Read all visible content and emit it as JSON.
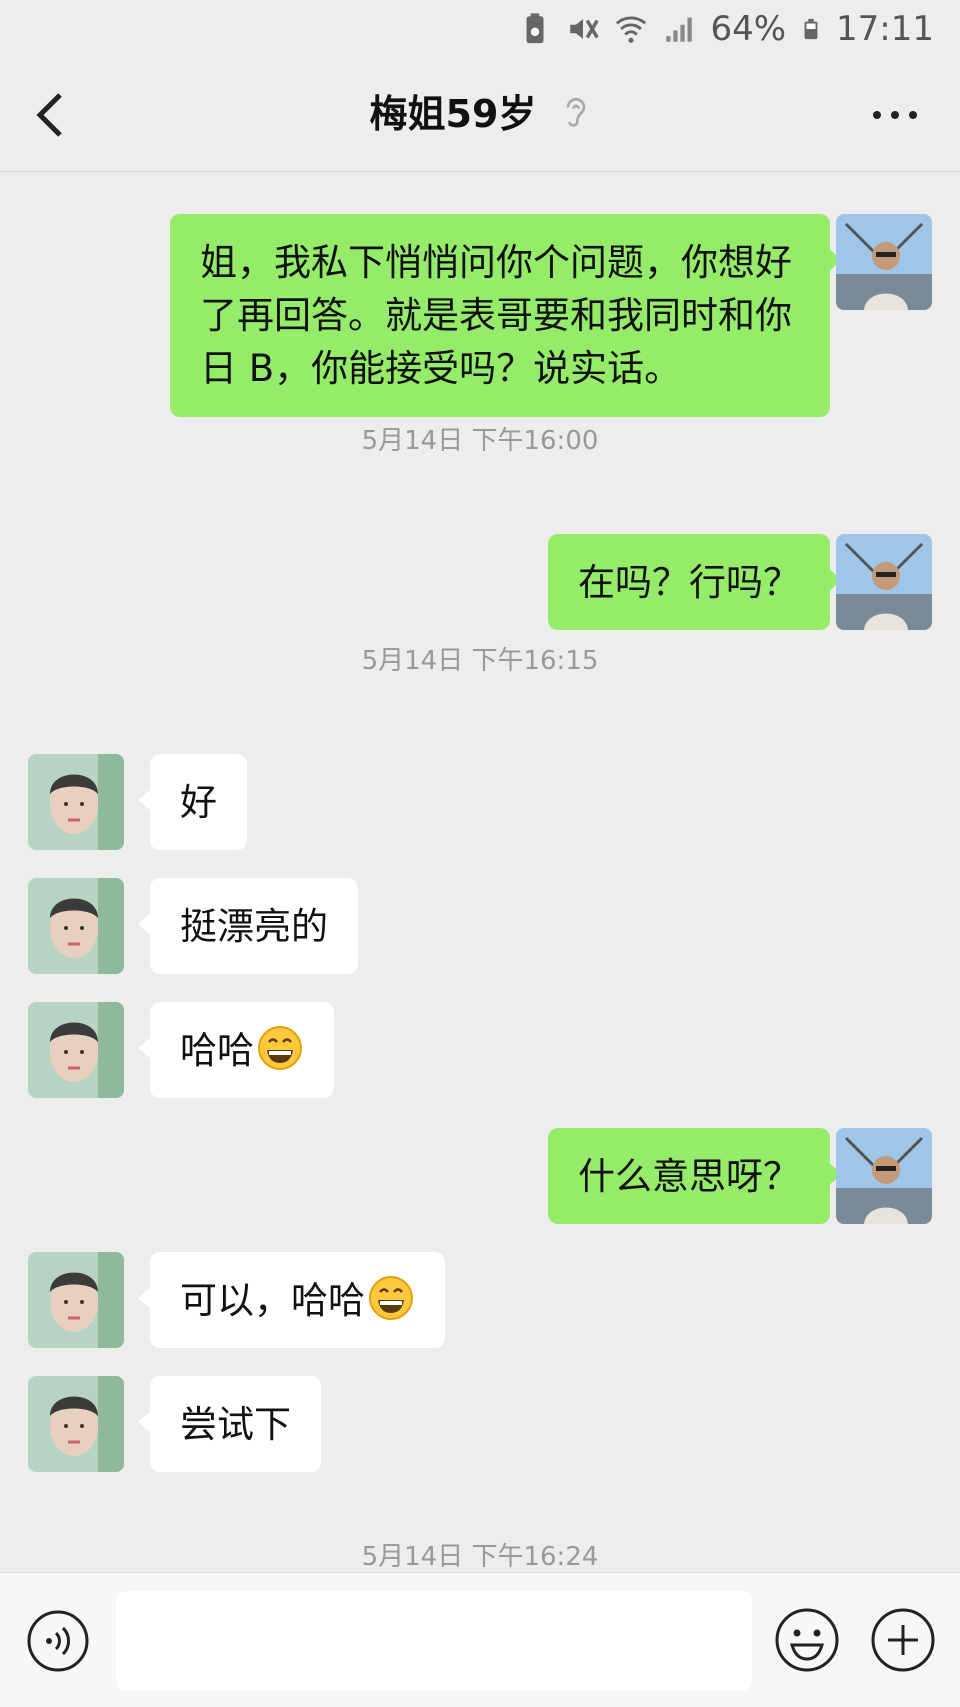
{
  "status_bar": {
    "battery_percent": "64%",
    "time": "17:11",
    "icons": [
      "battery-saver-icon",
      "mute-icon",
      "wifi-icon",
      "signal-icon",
      "battery-icon"
    ]
  },
  "header": {
    "title": "梅姐59岁",
    "icons": [
      "back-icon",
      "earpiece-icon",
      "more-icon"
    ]
  },
  "messages": [
    {
      "sender": "self",
      "text": "姐，我私下悄悄问你个问题，你想好了再回答。就是表哥要和我同时和你日 B，你能接受吗？说实话。"
    },
    {
      "type": "timestamp",
      "text": "5月14日 下午16:00"
    },
    {
      "sender": "self",
      "text": "在吗？行吗？"
    },
    {
      "type": "timestamp",
      "text": "5月14日 下午16:15"
    },
    {
      "sender": "peer",
      "text": "好"
    },
    {
      "sender": "peer",
      "text": "挺漂亮的"
    },
    {
      "sender": "peer",
      "text": "哈哈",
      "emoji": "grin-emoji"
    },
    {
      "sender": "self",
      "text": "什么意思呀？"
    },
    {
      "sender": "peer",
      "text": "可以，哈哈",
      "emoji": "grin-emoji"
    },
    {
      "sender": "peer",
      "text": "尝试下"
    },
    {
      "type": "timestamp",
      "text": "5月14日 下午16:24"
    }
  ],
  "input_bar": {
    "value": "",
    "icons": [
      "voice-icon",
      "emoji-icon",
      "plus-icon"
    ]
  },
  "colors": {
    "background": "#ededed",
    "self_bubble": "#95ec69",
    "peer_bubble": "#ffffff",
    "timestamp": "#999999"
  }
}
